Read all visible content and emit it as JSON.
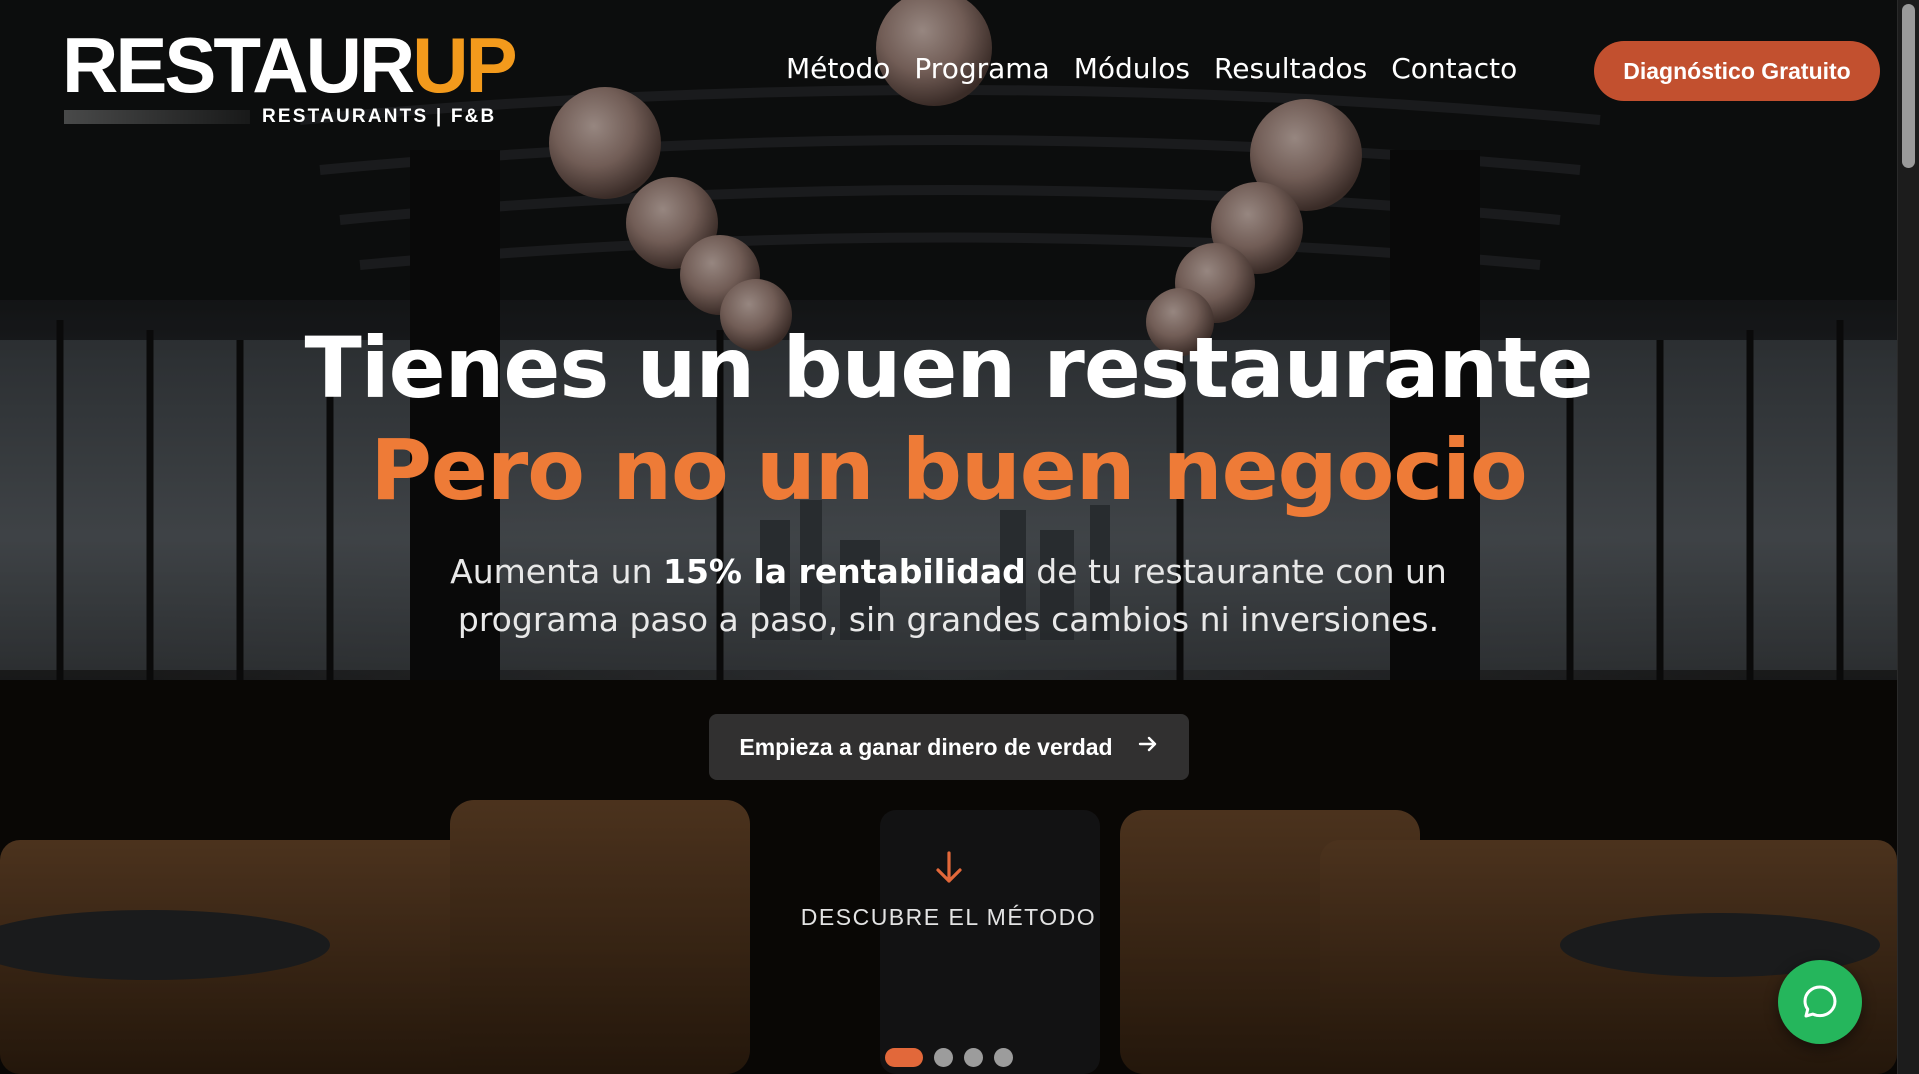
{
  "logo": {
    "main_white": "RESTAUR",
    "main_orange": "UP",
    "tagline": "RESTAURANTS | F&B"
  },
  "nav": {
    "items": [
      {
        "label": "Método"
      },
      {
        "label": "Programa"
      },
      {
        "label": "Módulos"
      },
      {
        "label": "Resultados"
      },
      {
        "label": "Contacto"
      }
    ],
    "cta_label": "Diagnóstico Gratuito"
  },
  "hero": {
    "title": "Tienes un buen restaurante",
    "subtitle": "Pero no un buen negocio",
    "description_line1_pre": "Aumenta un ",
    "description_line1_bold": "15% la rentabilidad",
    "description_line1_post": " de tu restaurante con un",
    "description_line2": "programa paso a paso, sin grandes cambios ni inversiones.",
    "cta_label": "Empieza a ganar dinero de verdad",
    "cta_icon": "arrow-right-icon",
    "discover_label": "DESCUBRE EL MÉTODO",
    "discover_icon": "arrow-down-icon"
  },
  "slider": {
    "total": 4,
    "active_index": 0
  },
  "chat": {
    "icon": "whatsapp-chat-icon"
  },
  "colors": {
    "accent_orange": "#ee7b37",
    "logo_orange": "#f39a1c",
    "cta_red": "#c2502f",
    "chat_green": "#25b65c"
  }
}
